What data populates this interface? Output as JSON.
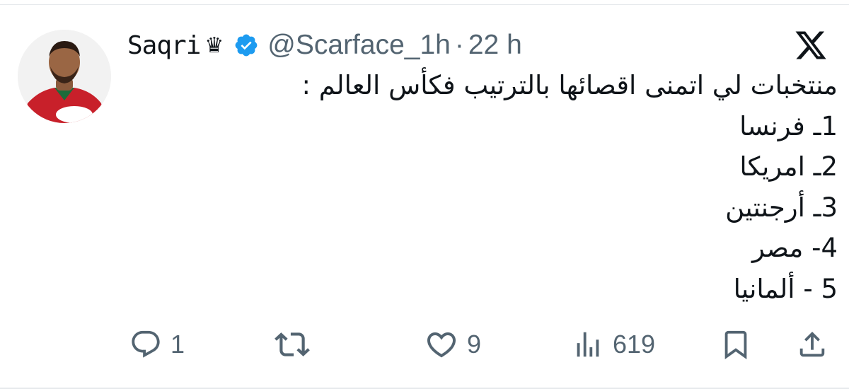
{
  "tweet": {
    "author": {
      "display_name": "Saqri",
      "crown_symbol": "♛",
      "verified": true,
      "handle": "@Scarface_1h",
      "separator": "·",
      "time": "22 h"
    },
    "body_lines": [
      "منتخبات لي اتمنى اقصائها بالترتيب فكأس العالم :",
      "1ـ فرنسا",
      "2ـ امريكا",
      "3ـ أرجنتين",
      "4- مصر",
      "5 - ألمانيا"
    ],
    "actions": {
      "reply": {
        "icon": "reply-icon",
        "count": "1"
      },
      "retweet": {
        "icon": "retweet-icon",
        "count": ""
      },
      "like": {
        "icon": "heart-icon",
        "count": "9"
      },
      "views": {
        "icon": "views-icon",
        "count": "619"
      },
      "bookmark": {
        "icon": "bookmark-icon"
      },
      "share": {
        "icon": "share-icon"
      }
    },
    "colors": {
      "text_primary": "#0f1419",
      "text_secondary": "#536471",
      "verified_blue": "#1d9bf0",
      "divider": "#e6e9ec"
    }
  }
}
